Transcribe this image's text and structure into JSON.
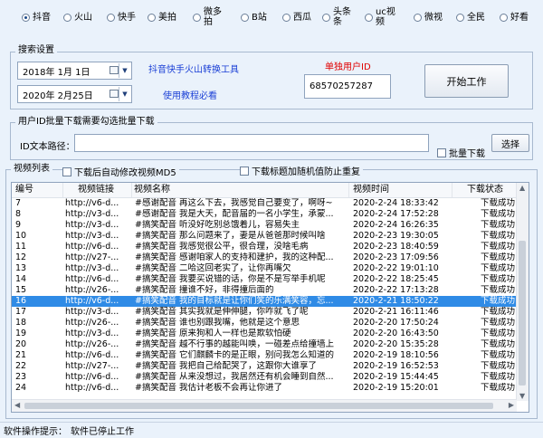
{
  "platforms": [
    {
      "label": "抖音",
      "selected": true
    },
    {
      "label": "火山",
      "selected": false
    },
    {
      "label": "快手",
      "selected": false
    },
    {
      "label": "美拍",
      "selected": false
    },
    {
      "label": "微多\n拍",
      "selected": false
    },
    {
      "label": "B站",
      "selected": false
    },
    {
      "label": "西瓜",
      "selected": false
    },
    {
      "label": "头条\n条",
      "selected": false
    },
    {
      "label": "uc视\n频",
      "selected": false
    },
    {
      "label": "微视",
      "selected": false
    },
    {
      "label": "全民",
      "selected": false
    },
    {
      "label": "好看",
      "selected": false
    }
  ],
  "search": {
    "group_title": "搜索设置",
    "start_date": "2018年  1月  1日",
    "end_date": "2020年  2月25日",
    "convert_link": "抖音快手火山转换工具",
    "tutorial_link": "使用教程必看",
    "single_user_label": "单独用户ID",
    "user_id_value": "68570257287",
    "start_button": "开始工作"
  },
  "batch": {
    "group_title": "用户ID批量下载需要勾选批量下载",
    "path_label": "ID文本路径：",
    "path_value": "",
    "batch_checkbox": "批量下载",
    "select_button": "选择"
  },
  "video_list": {
    "group_title": "视频列表",
    "auto_md5_checkbox": "下载后自动修改视频MD5",
    "random_title_checkbox": "下载标题加随机值防止重复",
    "columns": [
      "编号",
      "视频链接",
      "视频名称",
      "视频时间",
      "下载状态"
    ],
    "rows": [
      {
        "id": "7",
        "link": "http://v6-d...",
        "name": "#感谢配音 再这么下去，我感觉自己要变了，啊呀~",
        "time": "2020-2-24 18:33:42",
        "status": "下载成功"
      },
      {
        "id": "8",
        "link": "http://v3-d...",
        "name": "#感谢配音 我是大天，配音届的一名小学生，承蒙...",
        "time": "2020-2-24 17:52:28",
        "status": "下载成功"
      },
      {
        "id": "9",
        "link": "http://v3-d...",
        "name": "#搞笑配音 听没好吃别总饿着儿，容易失主",
        "time": "2020-2-24 16:26:35",
        "status": "下载成功"
      },
      {
        "id": "10",
        "link": "http://v3-d...",
        "name": "#搞笑配音 那么问题来了，妻是从爸爸那时候叫啥",
        "time": "2020-2-23 19:30:05",
        "status": "下载成功"
      },
      {
        "id": "11",
        "link": "http://v6-d...",
        "name": "#搞笑配音 我感觉很公平，很合理，没啥毛病",
        "time": "2020-2-23 18:40:59",
        "status": "下载成功"
      },
      {
        "id": "12",
        "link": "http://v27-...",
        "name": "#搞笑配音 感谢咱家人的支持和建护，我的这种配...",
        "time": "2020-2-23 17:09:56",
        "status": "下载成功"
      },
      {
        "id": "13",
        "link": "http://v3-d...",
        "name": "#搞笑配音 二哈这回老实了，让你再嘴欠",
        "time": "2020-2-22 19:01:10",
        "status": "下载成功"
      },
      {
        "id": "14",
        "link": "http://v6-d...",
        "name": "#搞笑配音 我要买说错的话，你是不是写举手机呢",
        "time": "2020-2-22 18:25:45",
        "status": "下载成功"
      },
      {
        "id": "15",
        "link": "http://v26-...",
        "name": "#搞笑配音 撞谁不好，非得撞后面的",
        "time": "2020-2-22 17:13:28",
        "status": "下载成功"
      },
      {
        "id": "16",
        "link": "http://v6-d...",
        "name": "#搞笑配音 我的目标就是让你们笑的乐满笑容，忘...",
        "time": "2020-2-21 18:50:22",
        "status": "下载成功",
        "selected": true
      },
      {
        "id": "17",
        "link": "http://v3-d...",
        "name": "#搞笑配音 其实我就是伸伸腿，你咋就飞了呢",
        "time": "2020-2-21 16:11:46",
        "status": "下载成功"
      },
      {
        "id": "18",
        "link": "http://v26-...",
        "name": "#搞笑配音 谁也别跟我嘴，他就是这个意思",
        "time": "2020-2-20 17:50:24",
        "status": "下载成功"
      },
      {
        "id": "19",
        "link": "http://v3-d...",
        "name": "#搞笑配音 原来狗和人一样也是欺软怕硬",
        "time": "2020-2-20 16:43:50",
        "status": "下载成功"
      },
      {
        "id": "20",
        "link": "http://v26-...",
        "name": "#搞笑配音 越不行事的越能叫唤，一碰差点给撞墙上",
        "time": "2020-2-20 15:35:28",
        "status": "下载成功"
      },
      {
        "id": "21",
        "link": "http://v6-d...",
        "name": "#搞笑配音 它们麒麟卡的是正眼，别问我怎么知道的",
        "time": "2020-2-19 18:10:56",
        "status": "下载成功"
      },
      {
        "id": "22",
        "link": "http://v27-...",
        "name": "#搞笑配音 我把自己给配哭了，这跟你大谁享了",
        "time": "2020-2-19 16:52:53",
        "status": "下载成功"
      },
      {
        "id": "23",
        "link": "http://v6-d...",
        "name": "#搞笑配音 从来没想过，我居然还有机会睡到自然...",
        "time": "2020-2-19 15:44:45",
        "status": "下载成功"
      },
      {
        "id": "24",
        "link": "http://v6-d...",
        "name": "#搞笑配音 我估计老板不会再让你进了",
        "time": "2020-2-19 15:20:01",
        "status": "下载成功"
      }
    ]
  },
  "status_bar": {
    "label": "软件操作提示：",
    "message": "软件已停止工作"
  }
}
